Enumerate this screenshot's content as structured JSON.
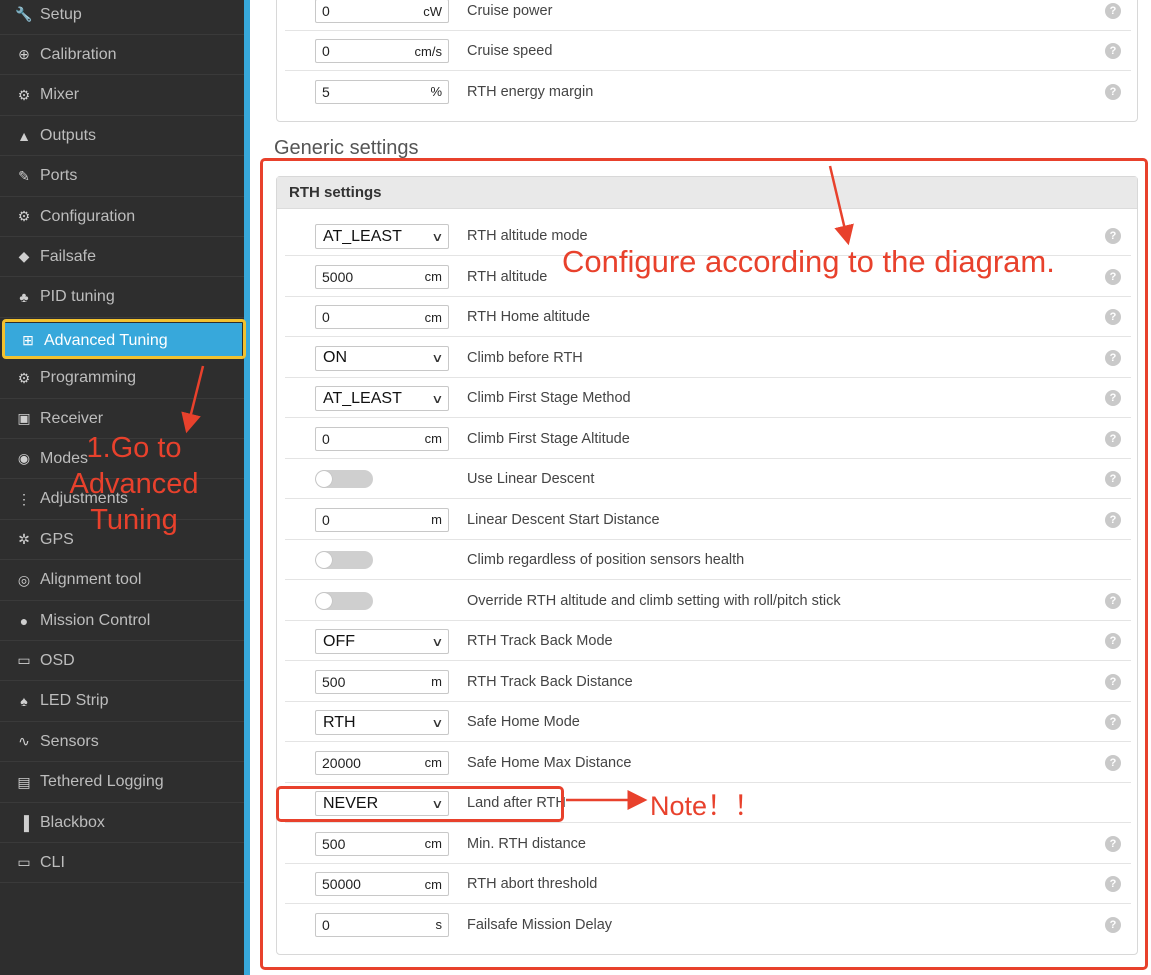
{
  "sidebar": {
    "items": [
      {
        "label": "Setup",
        "icon": "wrench-icon",
        "glyph": "🔧"
      },
      {
        "label": "Calibration",
        "icon": "crosshair-icon",
        "glyph": "⊕"
      },
      {
        "label": "Mixer",
        "icon": "mixer-icon",
        "glyph": "⚙"
      },
      {
        "label": "Outputs",
        "icon": "motor-icon",
        "glyph": "▲"
      },
      {
        "label": "Ports",
        "icon": "plug-icon",
        "glyph": "✎"
      },
      {
        "label": "Configuration",
        "icon": "gear-icon",
        "glyph": "⚙"
      },
      {
        "label": "Failsafe",
        "icon": "parachute-icon",
        "glyph": "◆"
      },
      {
        "label": "PID tuning",
        "icon": "sitemap-icon",
        "glyph": "♣"
      },
      {
        "label": "Advanced Tuning",
        "icon": "advanced-icon",
        "glyph": "⊞"
      },
      {
        "label": "Programming",
        "icon": "gear-icon",
        "glyph": "⚙"
      },
      {
        "label": "Receiver",
        "icon": "receiver-icon",
        "glyph": "▣"
      },
      {
        "label": "Modes",
        "icon": "toggle-icon",
        "glyph": "◉"
      },
      {
        "label": "Adjustments",
        "icon": "sliders-icon",
        "glyph": "⋮"
      },
      {
        "label": "GPS",
        "icon": "satellite-icon",
        "glyph": "✲"
      },
      {
        "label": "Alignment tool",
        "icon": "compass-icon",
        "glyph": "◎"
      },
      {
        "label": "Mission Control",
        "icon": "map-pin-icon",
        "glyph": "●"
      },
      {
        "label": "OSD",
        "icon": "osd-icon",
        "glyph": "▭"
      },
      {
        "label": "LED Strip",
        "icon": "led-icon",
        "glyph": "♠"
      },
      {
        "label": "Sensors",
        "icon": "pulse-icon",
        "glyph": "∿"
      },
      {
        "label": "Tethered Logging",
        "icon": "log-icon",
        "glyph": "▤"
      },
      {
        "label": "Blackbox",
        "icon": "blackbox-icon",
        "glyph": "▐"
      },
      {
        "label": "CLI",
        "icon": "terminal-icon",
        "glyph": "▭"
      }
    ],
    "active_index": 8,
    "accent": "#37a8db"
  },
  "top_panel": {
    "rows": [
      {
        "value": "0",
        "unit": "cW",
        "label": "Cruise power"
      },
      {
        "value": "0",
        "unit": "cm/s",
        "label": "Cruise speed"
      },
      {
        "value": "5",
        "unit": "%",
        "label": "RTH energy margin"
      }
    ]
  },
  "generic": {
    "section_title": "Generic settings",
    "panel_title": "RTH settings",
    "rows": [
      {
        "type": "select",
        "value": "AT_LEAST",
        "label": "RTH altitude mode",
        "help": true
      },
      {
        "type": "input",
        "value": "5000",
        "unit": "cm",
        "label": "RTH altitude",
        "help": true
      },
      {
        "type": "input",
        "value": "0",
        "unit": "cm",
        "label": "RTH Home altitude",
        "help": true
      },
      {
        "type": "select",
        "value": "ON",
        "label": "Climb before RTH",
        "help": true
      },
      {
        "type": "select",
        "value": "AT_LEAST",
        "label": "Climb First Stage Method",
        "help": true
      },
      {
        "type": "input",
        "value": "0",
        "unit": "cm",
        "label": "Climb First Stage Altitude",
        "help": true
      },
      {
        "type": "toggle",
        "label": "Use Linear Descent",
        "help": true
      },
      {
        "type": "input",
        "value": "0",
        "unit": "m",
        "label": "Linear Descent Start Distance",
        "help": true
      },
      {
        "type": "toggle",
        "label": "Climb regardless of position sensors health",
        "help": false
      },
      {
        "type": "toggle",
        "label": "Override RTH altitude and climb setting with roll/pitch stick",
        "help": true
      },
      {
        "type": "select",
        "value": "OFF",
        "label": "RTH Track Back Mode",
        "help": true
      },
      {
        "type": "input",
        "value": "500",
        "unit": "m",
        "label": "RTH Track Back Distance",
        "help": true
      },
      {
        "type": "select",
        "value": "RTH",
        "label": "Safe Home Mode",
        "help": true
      },
      {
        "type": "input",
        "value": "20000",
        "unit": "cm",
        "label": "Safe Home Max Distance",
        "help": true
      },
      {
        "type": "select",
        "value": "NEVER",
        "label": "Land after RTH",
        "help": false
      },
      {
        "type": "input",
        "value": "500",
        "unit": "cm",
        "label": "Min. RTH distance",
        "help": true
      },
      {
        "type": "input",
        "value": "50000",
        "unit": "cm",
        "label": "RTH abort threshold",
        "help": true
      },
      {
        "type": "input",
        "value": "0",
        "unit": "s",
        "label": "Failsafe Mission Delay",
        "help": true
      }
    ]
  },
  "annotations": {
    "configure_text": "Configure according to the diagram.",
    "step1_line1": "1.Go to",
    "step1_line2": "Advanced",
    "step1_line3": "Tuning",
    "note_text": "Note！！",
    "color": "#e8412c"
  },
  "help_glyph": "?"
}
